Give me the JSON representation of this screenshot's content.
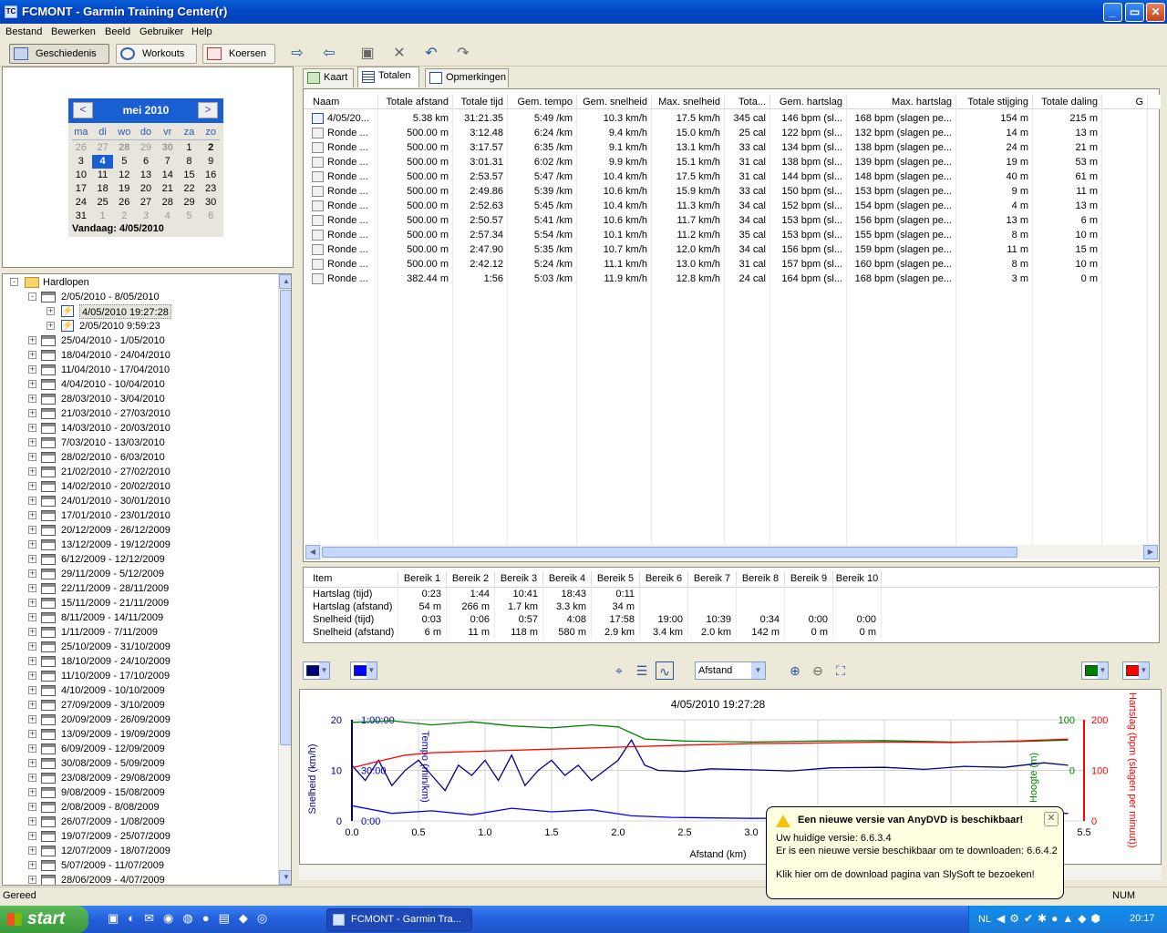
{
  "window": {
    "title": "FCMONT - Garmin Training Center(r)",
    "icon": "TC"
  },
  "menu": [
    "Bestand",
    "Bewerken",
    "Beeld",
    "Gebruiker",
    "Help"
  ],
  "toolbar": {
    "history": "Geschiedenis",
    "workouts": "Workouts",
    "courses": "Koersen"
  },
  "calendar": {
    "month": "mei 2010",
    "prev": "<",
    "next": ">",
    "dow": [
      "ma",
      "di",
      "wo",
      "do",
      "vr",
      "za",
      "zo"
    ],
    "weeks": [
      [
        "26",
        "27",
        "28",
        "29",
        "30",
        "1",
        "2"
      ],
      [
        "3",
        "4",
        "5",
        "6",
        "7",
        "8",
        "9"
      ],
      [
        "10",
        "11",
        "12",
        "13",
        "14",
        "15",
        "16"
      ],
      [
        "17",
        "18",
        "19",
        "20",
        "21",
        "22",
        "23"
      ],
      [
        "24",
        "25",
        "26",
        "27",
        "28",
        "29",
        "30"
      ],
      [
        "31",
        "1",
        "2",
        "3",
        "4",
        "5",
        "6"
      ]
    ],
    "today": "Vandaag: 4/05/2010"
  },
  "tree": {
    "root": "Hardlopen",
    "open_week": "2/05/2010 - 8/05/2010",
    "activities": [
      "4/05/2010 19:27:28",
      "2/05/2010 9:59:23"
    ],
    "weeks": [
      "25/04/2010 - 1/05/2010",
      "18/04/2010 - 24/04/2010",
      "11/04/2010 - 17/04/2010",
      "4/04/2010 - 10/04/2010",
      "28/03/2010 - 3/04/2010",
      "21/03/2010 - 27/03/2010",
      "14/03/2010 - 20/03/2010",
      "7/03/2010 - 13/03/2010",
      "28/02/2010 - 6/03/2010",
      "21/02/2010 - 27/02/2010",
      "14/02/2010 - 20/02/2010",
      "24/01/2010 - 30/01/2010",
      "17/01/2010 - 23/01/2010",
      "20/12/2009 - 26/12/2009",
      "13/12/2009 - 19/12/2009",
      "6/12/2009 - 12/12/2009",
      "29/11/2009 - 5/12/2009",
      "22/11/2009 - 28/11/2009",
      "15/11/2009 - 21/11/2009",
      "8/11/2009 - 14/11/2009",
      "1/11/2009 - 7/11/2009",
      "25/10/2009 - 31/10/2009",
      "18/10/2009 - 24/10/2009",
      "11/10/2009 - 17/10/2009",
      "4/10/2009 - 10/10/2009",
      "27/09/2009 - 3/10/2009",
      "20/09/2009 - 26/09/2009",
      "13/09/2009 - 19/09/2009",
      "6/09/2009 - 12/09/2009",
      "30/08/2009 - 5/09/2009",
      "23/08/2009 - 29/08/2009",
      "9/08/2009 - 15/08/2009",
      "2/08/2009 - 8/08/2009",
      "26/07/2009 - 1/08/2009",
      "19/07/2009 - 25/07/2009",
      "12/07/2009 - 18/07/2009",
      "5/07/2009 - 11/07/2009",
      "28/06/2009 - 4/07/2009"
    ]
  },
  "tabs": [
    "Kaart",
    "Totalen",
    "Opmerkingen"
  ],
  "totals": {
    "columns": [
      "Naam",
      "Totale afstand",
      "Totale tijd",
      "Gem. tempo",
      "Gem. snelheid",
      "Max. snelheid",
      "Tota...",
      "Gem. hartslag",
      "Max. hartslag",
      "Totale stijging",
      "Totale daling",
      "G"
    ],
    "rows": [
      [
        "4/05/20...",
        "5.38 km",
        "31:21.35",
        "5:49 /km",
        "10.3 km/h",
        "17.5 km/h",
        "345 cal",
        "146 bpm (sl...",
        "168 bpm (slagen pe...",
        "154 m",
        "215 m"
      ],
      [
        "Ronde ...",
        "500.00 m",
        "3:12.48",
        "6:24 /km",
        "9.4 km/h",
        "15.0 km/h",
        "25 cal",
        "122 bpm (sl...",
        "132 bpm (slagen pe...",
        "14 m",
        "13 m"
      ],
      [
        "Ronde ...",
        "500.00 m",
        "3:17.57",
        "6:35 /km",
        "9.1 km/h",
        "13.1 km/h",
        "33 cal",
        "134 bpm (sl...",
        "138 bpm (slagen pe...",
        "24 m",
        "21 m"
      ],
      [
        "Ronde ...",
        "500.00 m",
        "3:01.31",
        "6:02 /km",
        "9.9 km/h",
        "15.1 km/h",
        "31 cal",
        "138 bpm (sl...",
        "139 bpm (slagen pe...",
        "19 m",
        "53 m"
      ],
      [
        "Ronde ...",
        "500.00 m",
        "2:53.57",
        "5:47 /km",
        "10.4 km/h",
        "17.5 km/h",
        "31 cal",
        "144 bpm (sl...",
        "148 bpm (slagen pe...",
        "40 m",
        "61 m"
      ],
      [
        "Ronde ...",
        "500.00 m",
        "2:49.86",
        "5:39 /km",
        "10.6 km/h",
        "15.9 km/h",
        "33 cal",
        "150 bpm (sl...",
        "153 bpm (slagen pe...",
        "9 m",
        "11 m"
      ],
      [
        "Ronde ...",
        "500.00 m",
        "2:52.63",
        "5:45 /km",
        "10.4 km/h",
        "11.3 km/h",
        "34 cal",
        "152 bpm (sl...",
        "154 bpm (slagen pe...",
        "4 m",
        "13 m"
      ],
      [
        "Ronde ...",
        "500.00 m",
        "2:50.57",
        "5:41 /km",
        "10.6 km/h",
        "11.7 km/h",
        "34 cal",
        "153 bpm (sl...",
        "156 bpm (slagen pe...",
        "13 m",
        "6 m"
      ],
      [
        "Ronde ...",
        "500.00 m",
        "2:57.34",
        "5:54 /km",
        "10.1 km/h",
        "11.2 km/h",
        "35 cal",
        "153 bpm (sl...",
        "155 bpm (slagen pe...",
        "8 m",
        "10 m"
      ],
      [
        "Ronde ...",
        "500.00 m",
        "2:47.90",
        "5:35 /km",
        "10.7 km/h",
        "12.0 km/h",
        "34 cal",
        "156 bpm (sl...",
        "159 bpm (slagen pe...",
        "11 m",
        "15 m"
      ],
      [
        "Ronde ...",
        "500.00 m",
        "2:42.12",
        "5:24 /km",
        "11.1 km/h",
        "13.0 km/h",
        "31 cal",
        "157 bpm (sl...",
        "160 bpm (slagen pe...",
        "8 m",
        "10 m"
      ],
      [
        "Ronde ...",
        "382.44 m",
        "1:56",
        "5:03 /km",
        "11.9 km/h",
        "12.8 km/h",
        "24 cal",
        "164 bpm (sl...",
        "168 bpm (slagen pe...",
        "3 m",
        "0 m"
      ]
    ]
  },
  "zones": {
    "columns": [
      "Item",
      "Bereik 1",
      "Bereik 2",
      "Bereik 3",
      "Bereik 4",
      "Bereik 5",
      "Bereik 6",
      "Bereik 7",
      "Bereik 8",
      "Bereik 9",
      "Bereik 10"
    ],
    "rows": [
      [
        "Hartslag (tijd)",
        "0:23",
        "1:44",
        "10:41",
        "18:43",
        "0:11",
        "",
        "",
        "",
        "",
        ""
      ],
      [
        "Hartslag (afstand)",
        "54 m",
        "266 m",
        "1.7 km",
        "3.3 km",
        "34 m",
        "",
        "",
        "",
        "",
        ""
      ],
      [
        "Snelheid (tijd)",
        "0:03",
        "0:06",
        "0:57",
        "4:08",
        "17:58",
        "19:00",
        "10:39",
        "0:34",
        "0:00",
        "0:00"
      ],
      [
        "Snelheid (afstand)",
        "6 m",
        "11 m",
        "118 m",
        "580 m",
        "2.9 km",
        "3.4 km",
        "2.0 km",
        "142 m",
        "0 m",
        "0 m"
      ]
    ]
  },
  "chart_controls": {
    "xaxis_select": "Afstand",
    "colors": {
      "left1": "#000080",
      "left2": "#0000ff",
      "right1": "#008000",
      "right2": "#ff0000"
    }
  },
  "chart_data": {
    "type": "line",
    "title": "4/05/2010 19:27:28",
    "xlabel": "Afstand (km)",
    "xlim": [
      0,
      5.5
    ],
    "xticks": [
      "0.0",
      "0.5",
      "1.0",
      "1.5",
      "2.0",
      "2.5",
      "3.0",
      "3.5",
      "4.0",
      "4.5",
      "5.0",
      "5.5"
    ],
    "left_axis": {
      "label": "Snelheid (km/h)",
      "ticks": [
        "0",
        "10",
        "20"
      ],
      "ylim": [
        0,
        20
      ]
    },
    "left_axis2": {
      "label": "Tempo (min/km)",
      "ticks": [
        "0:00",
        "30:00",
        "1:00:00"
      ]
    },
    "right_axis": {
      "label": "Hartslag (bpm (slagen per minuut))",
      "ticks": [
        "0",
        "100",
        "200"
      ],
      "ylim": [
        0,
        200
      ]
    },
    "right_axis2": {
      "label": "Hoogte (m)",
      "ticks": [
        "0",
        "100"
      ]
    },
    "series": [
      {
        "name": "Snelheid (km/h)",
        "color": "#000080",
        "x": [
          0,
          0.1,
          0.2,
          0.3,
          0.4,
          0.5,
          0.6,
          0.7,
          0.8,
          0.9,
          1.0,
          1.1,
          1.2,
          1.3,
          1.4,
          1.5,
          1.6,
          1.7,
          1.8,
          1.9,
          2.0,
          2.1,
          2.2,
          2.3,
          2.5,
          2.7,
          3.0,
          3.3,
          3.6,
          4.0,
          4.3,
          4.6,
          4.9,
          5.2,
          5.38
        ],
        "y": [
          11,
          8,
          12,
          7,
          10,
          12,
          9,
          6,
          11,
          9,
          12,
          8,
          13,
          7,
          10,
          12,
          9,
          11,
          8,
          10,
          12,
          16,
          11,
          10,
          9.8,
          10.3,
          10.1,
          9.9,
          10.5,
          10.6,
          10.2,
          10.8,
          10.6,
          11.5,
          11
        ]
      },
      {
        "name": "Tempo (min/km)",
        "color": "#0000ff",
        "x": [
          0,
          0.3,
          0.6,
          0.9,
          1.2,
          1.5,
          1.8,
          2.1,
          2.4,
          3.0,
          3.6,
          4.2,
          4.8,
          5.38
        ],
        "y": [
          3,
          1.5,
          2,
          1.2,
          2.5,
          1.8,
          2.2,
          1.0,
          0.7,
          0.5,
          0.6,
          0.8,
          1.2,
          1.5
        ]
      },
      {
        "name": "Hoogte (m)",
        "color": "#008000",
        "x": [
          0,
          0.3,
          0.6,
          0.9,
          1.2,
          1.5,
          1.8,
          2.0,
          2.2,
          2.5,
          3.0,
          3.5,
          4.0,
          4.5,
          5.0,
          5.38
        ],
        "y": [
          95,
          98,
          90,
          96,
          88,
          84,
          90,
          86,
          62,
          58,
          56,
          58,
          59,
          56,
          57,
          60
        ]
      },
      {
        "name": "Hartslag (bpm)",
        "color": "#ff0000",
        "x": [
          0,
          0.2,
          0.4,
          0.6,
          1.0,
          1.5,
          2.0,
          2.5,
          3.0,
          3.5,
          4.0,
          4.5,
          5.0,
          5.38
        ],
        "y": [
          105,
          118,
          130,
          135,
          138,
          142,
          146,
          150,
          153,
          154,
          156,
          155,
          158,
          162
        ]
      }
    ]
  },
  "status": {
    "left": "Gereed",
    "num": "NUM"
  },
  "taskbar": {
    "start": "start",
    "item": "FCMONT - Garmin Tra...",
    "lang": "NL",
    "clock": "20:17"
  },
  "balloon": {
    "title": "Een nieuwe versie van AnyDVD is beschikbaar!",
    "line1": "Uw huidige versie: 6.6.3.4",
    "line2": "Er is een nieuwe versie beschikbaar om te downloaden: 6.6.4.2",
    "line3": "Klik hier om de download pagina van SlySoft te bezoeken!"
  }
}
